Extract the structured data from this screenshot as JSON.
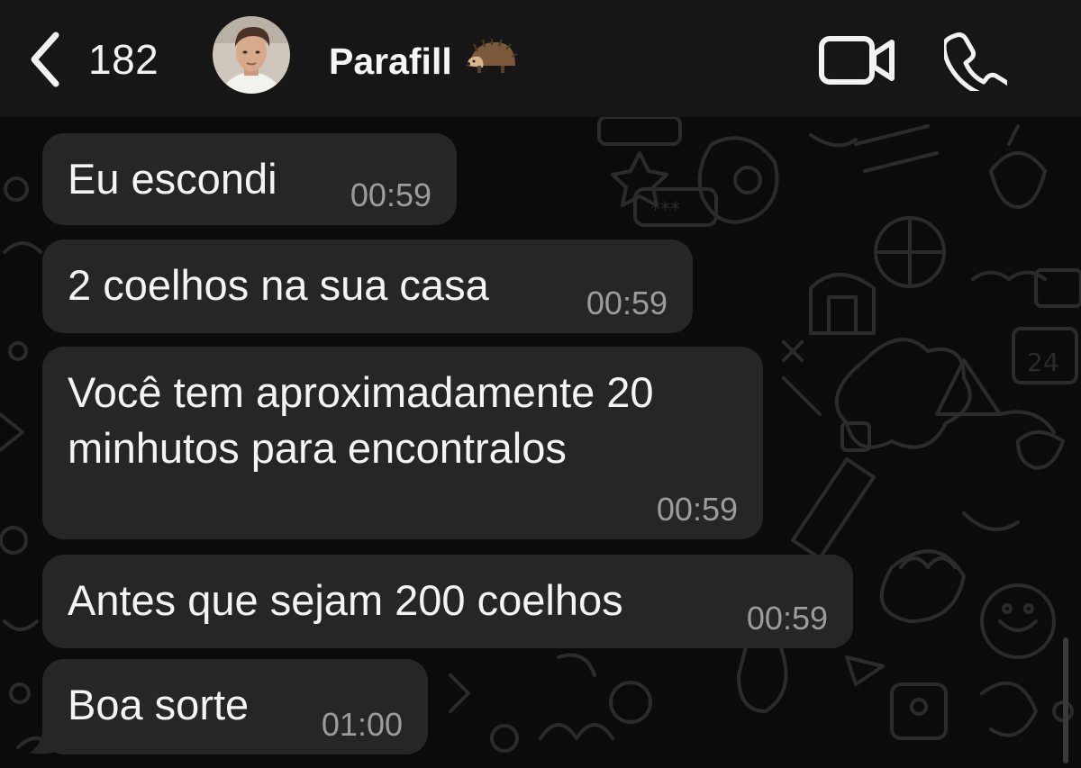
{
  "header": {
    "back_count": "182",
    "contact_name": "Parafill",
    "contact_emoji": "hedgehog-icon"
  },
  "messages": [
    {
      "text": "Eu escondi",
      "time": "00:59"
    },
    {
      "text": "2 coelhos na sua casa",
      "time": "00:59"
    },
    {
      "text": "Você tem aproximadamente 20\nminhutos para encontralos",
      "time": "00:59"
    },
    {
      "text": "Antes que sejam 200 coelhos",
      "time": "00:59"
    },
    {
      "text": "Boa sorte",
      "time": "01:00"
    }
  ],
  "colors": {
    "background": "#0b0b0b",
    "header": "#161616",
    "bubble": "#262626",
    "text": "#f4f4f4",
    "timestamp": "#9c9c9c"
  }
}
